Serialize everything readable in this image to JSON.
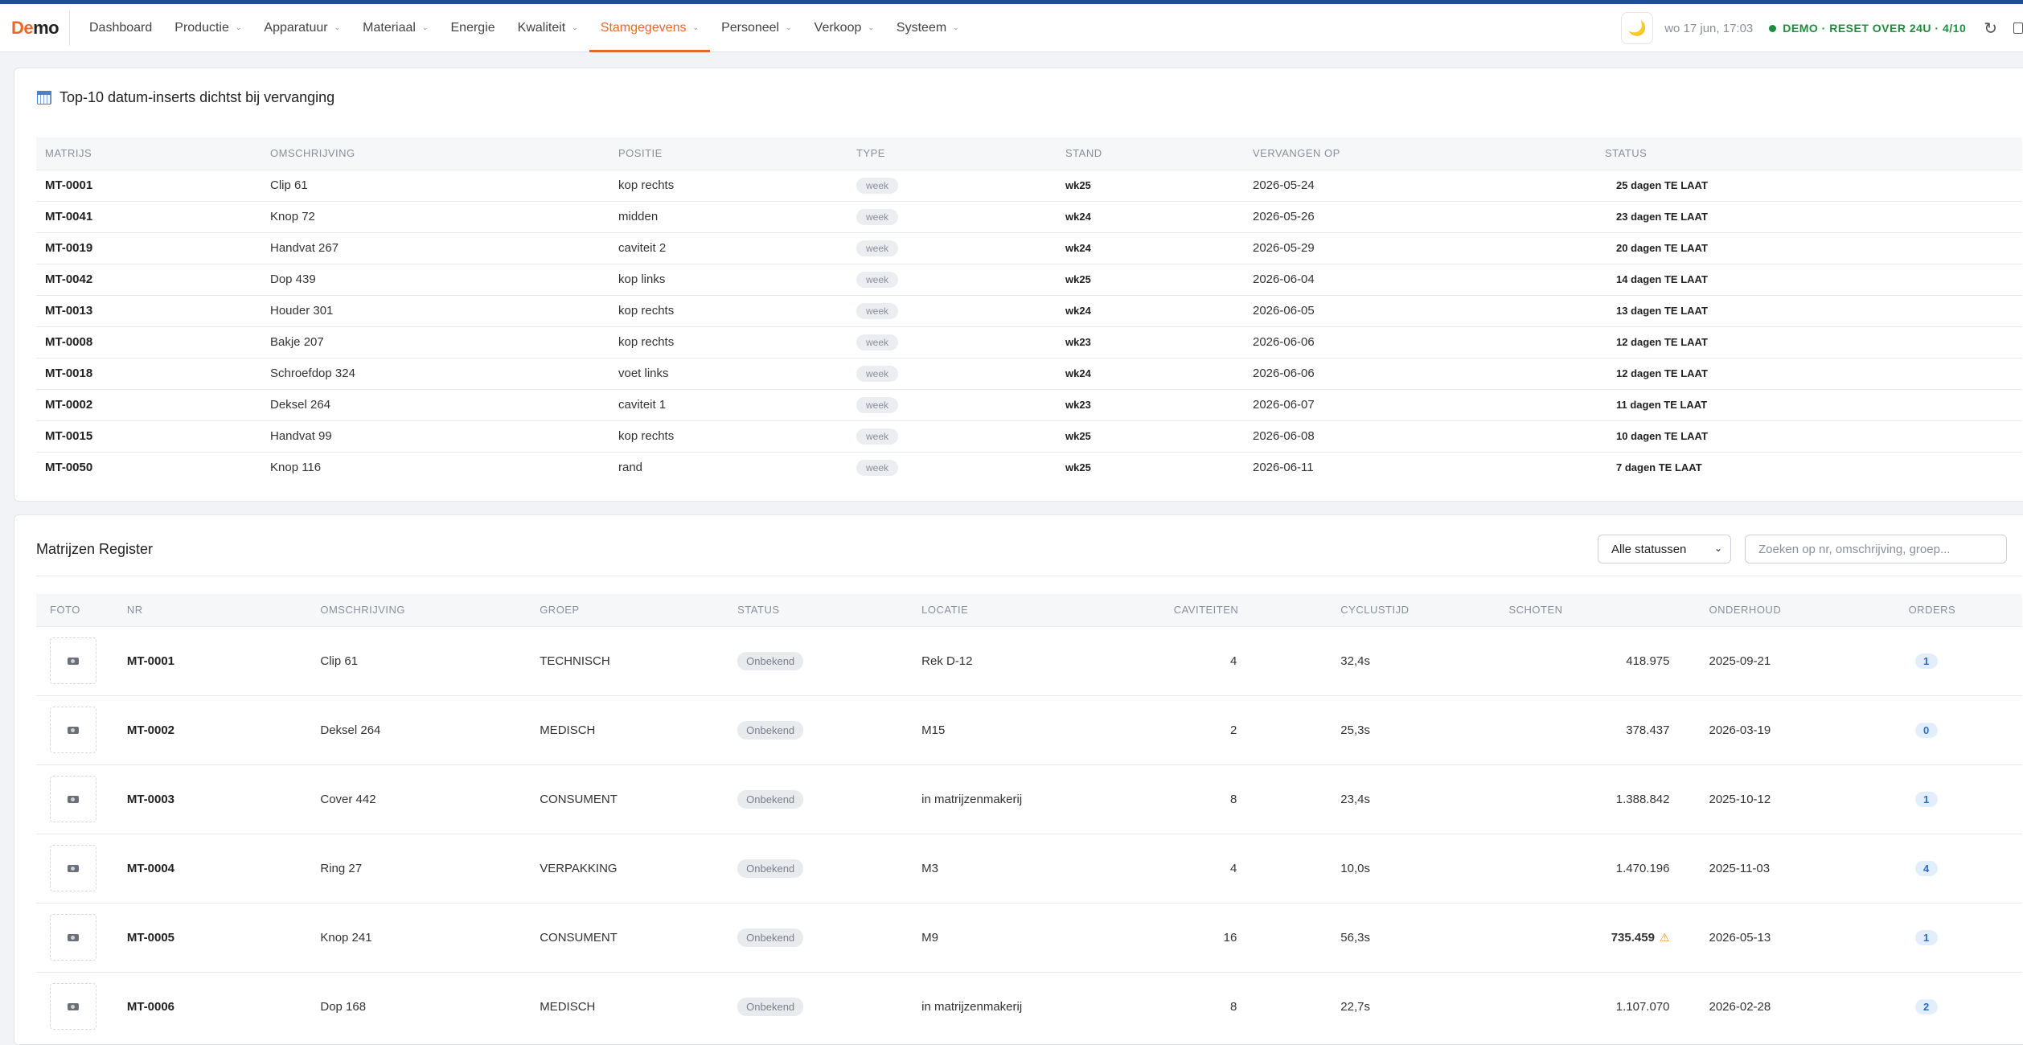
{
  "nav": {
    "logo_a": "De",
    "logo_b": "mo",
    "items": [
      {
        "label": "Dashboard",
        "caret": false
      },
      {
        "label": "Productie",
        "caret": true
      },
      {
        "label": "Apparatuur",
        "caret": true
      },
      {
        "label": "Materiaal",
        "caret": true
      },
      {
        "label": "Energie",
        "caret": false
      },
      {
        "label": "Kwaliteit",
        "caret": true
      },
      {
        "label": "Stamgegevens",
        "caret": true,
        "active": true
      },
      {
        "label": "Personeel",
        "caret": true
      },
      {
        "label": "Verkoop",
        "caret": true
      },
      {
        "label": "Systeem",
        "caret": true
      }
    ],
    "datetime": "wo 17 jun, 17:03",
    "demo_status": "DEMO · RESET OVER 24U · 4/10",
    "refresh_glyph": "↻",
    "theme_icon": "moon-icon",
    "accent_color": "#e8682c",
    "top_bar_color": "#1e4f96"
  },
  "top10": {
    "title": "Top-10 datum-inserts dichtst bij vervanging",
    "columns": [
      "MATRIJS",
      "OMSCHRIJVING",
      "POSITIE",
      "TYPE",
      "STAND",
      "VERVANGEN OP",
      "STATUS"
    ],
    "rows": [
      {
        "matrijs": "MT-0001",
        "omschrijving": "Clip 61",
        "positie": "kop rechts",
        "type": "week",
        "stand": "wk25",
        "vervangen": "2026-05-24",
        "status": "25 dagen TE LAAT"
      },
      {
        "matrijs": "MT-0041",
        "omschrijving": "Knop 72",
        "positie": "midden",
        "type": "week",
        "stand": "wk24",
        "vervangen": "2026-05-26",
        "status": "23 dagen TE LAAT"
      },
      {
        "matrijs": "MT-0019",
        "omschrijving": "Handvat 267",
        "positie": "caviteit 2",
        "type": "week",
        "stand": "wk24",
        "vervangen": "2026-05-29",
        "status": "20 dagen TE LAAT"
      },
      {
        "matrijs": "MT-0042",
        "omschrijving": "Dop 439",
        "positie": "kop links",
        "type": "week",
        "stand": "wk25",
        "vervangen": "2026-06-04",
        "status": "14 dagen TE LAAT"
      },
      {
        "matrijs": "MT-0013",
        "omschrijving": "Houder 301",
        "positie": "kop rechts",
        "type": "week",
        "stand": "wk24",
        "vervangen": "2026-06-05",
        "status": "13 dagen TE LAAT"
      },
      {
        "matrijs": "MT-0008",
        "omschrijving": "Bakje 207",
        "positie": "kop rechts",
        "type": "week",
        "stand": "wk23",
        "vervangen": "2026-06-06",
        "status": "12 dagen TE LAAT"
      },
      {
        "matrijs": "MT-0018",
        "omschrijving": "Schroefdop 324",
        "positie": "voet links",
        "type": "week",
        "stand": "wk24",
        "vervangen": "2026-06-06",
        "status": "12 dagen TE LAAT"
      },
      {
        "matrijs": "MT-0002",
        "omschrijving": "Deksel 264",
        "positie": "caviteit 1",
        "type": "week",
        "stand": "wk23",
        "vervangen": "2026-06-07",
        "status": "11 dagen TE LAAT"
      },
      {
        "matrijs": "MT-0015",
        "omschrijving": "Handvat 99",
        "positie": "kop rechts",
        "type": "week",
        "stand": "wk25",
        "vervangen": "2026-06-08",
        "status": "10 dagen TE LAAT"
      },
      {
        "matrijs": "MT-0050",
        "omschrijving": "Knop 116",
        "positie": "rand",
        "type": "week",
        "stand": "wk25",
        "vervangen": "2026-06-11",
        "status": "7 dagen TE LAAT"
      }
    ]
  },
  "register": {
    "title": "Matrijzen Register",
    "status_filter": "Alle statussen",
    "search_placeholder": "Zoeken op nr, omschrijving, groep...",
    "columns": [
      "FOTO",
      "NR",
      "OMSCHRIJVING",
      "GROEP",
      "STATUS",
      "LOCATIE",
      "CAVITEITEN",
      "CYCLUSTIJD",
      "SCHOTEN",
      "ONDERHOUD",
      "ORDERS"
    ],
    "rows": [
      {
        "nr": "MT-0001",
        "omschrijving": "Clip 61",
        "groep": "TECHNISCH",
        "status": "Onbekend",
        "locatie": "Rek D-12",
        "caviteiten": "4",
        "cyclustijd": "32,4s",
        "schoten": "418.975",
        "schoten_warning": false,
        "onderhoud": "2025-09-21",
        "orders": "1"
      },
      {
        "nr": "MT-0002",
        "omschrijving": "Deksel 264",
        "groep": "MEDISCH",
        "status": "Onbekend",
        "locatie": "M15",
        "caviteiten": "2",
        "cyclustijd": "25,3s",
        "schoten": "378.437",
        "schoten_warning": false,
        "onderhoud": "2026-03-19",
        "orders": "0"
      },
      {
        "nr": "MT-0003",
        "omschrijving": "Cover 442",
        "groep": "CONSUMENT",
        "status": "Onbekend",
        "locatie": "in matrijzenmakerij",
        "caviteiten": "8",
        "cyclustijd": "23,4s",
        "schoten": "1.388.842",
        "schoten_warning": false,
        "onderhoud": "2025-10-12",
        "orders": "1"
      },
      {
        "nr": "MT-0004",
        "omschrijving": "Ring 27",
        "groep": "VERPAKKING",
        "status": "Onbekend",
        "locatie": "M3",
        "caviteiten": "4",
        "cyclustijd": "10,0s",
        "schoten": "1.470.196",
        "schoten_warning": false,
        "onderhoud": "2025-11-03",
        "orders": "4"
      },
      {
        "nr": "MT-0005",
        "omschrijving": "Knop 241",
        "groep": "CONSUMENT",
        "status": "Onbekend",
        "locatie": "M9",
        "caviteiten": "16",
        "cyclustijd": "56,3s",
        "schoten": "735.459",
        "schoten_warning": true,
        "onderhoud": "2026-05-13",
        "orders": "1"
      },
      {
        "nr": "MT-0006",
        "omschrijving": "Dop 168",
        "groep": "MEDISCH",
        "status": "Onbekend",
        "locatie": "in matrijzenmakerij",
        "caviteiten": "8",
        "cyclustijd": "22,7s",
        "schoten": "1.107.070",
        "schoten_warning": false,
        "onderhoud": "2026-02-28",
        "orders": "2"
      }
    ]
  }
}
